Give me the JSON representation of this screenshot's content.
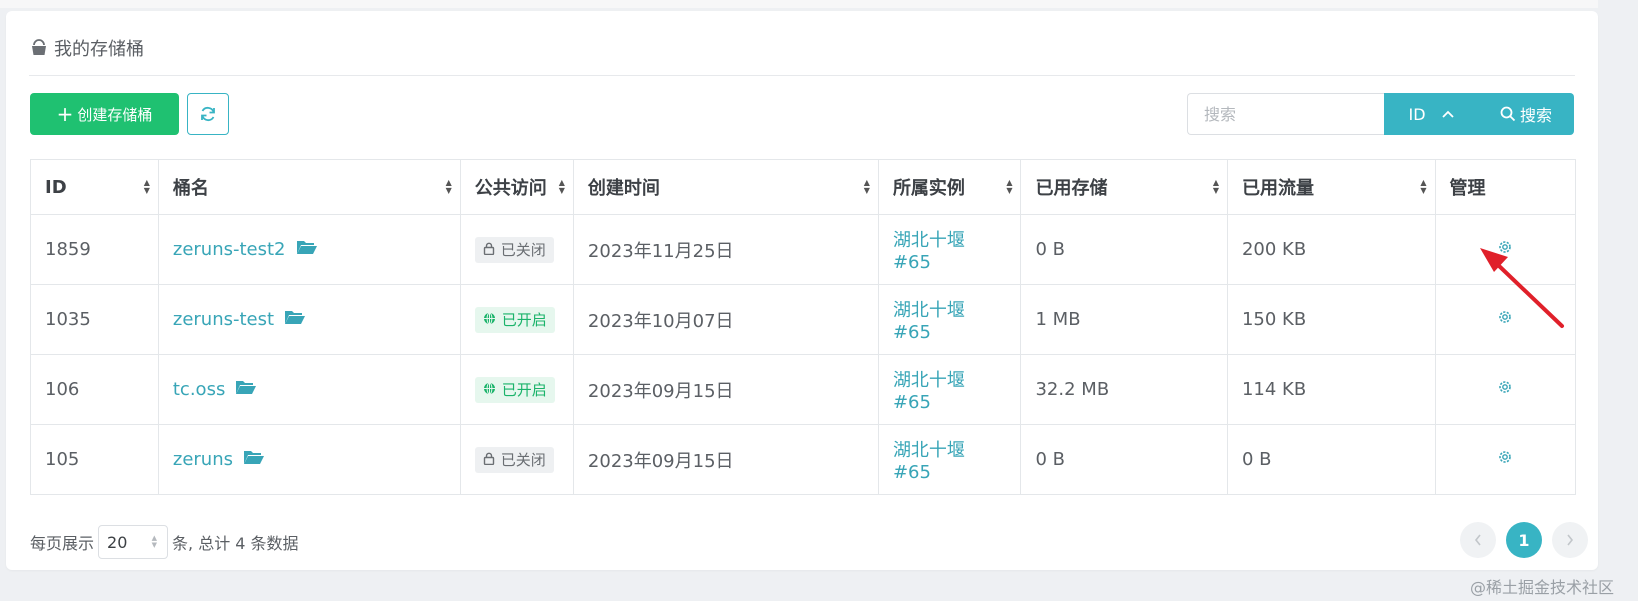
{
  "page": {
    "title": "我的存储桶"
  },
  "toolbar": {
    "create_label": "创建存储桶",
    "refresh_icon": "refresh-icon"
  },
  "search": {
    "placeholder": "搜索",
    "field": "ID",
    "button_label": "搜索"
  },
  "table": {
    "headers": [
      "ID",
      "桶名",
      "公共访问",
      "创建时间",
      "所属实例",
      "已用存储",
      "已用流量",
      "管理"
    ],
    "rows": [
      {
        "id": "1859",
        "name": "zeruns-test2",
        "access": "已关闭",
        "access_state": "closed",
        "created": "2023年11月25日",
        "instance": "湖北十堰 #65",
        "storage": "0 B",
        "traffic": "200 KB"
      },
      {
        "id": "1035",
        "name": "zeruns-test",
        "access": "已开启",
        "access_state": "open",
        "created": "2023年10月07日",
        "instance": "湖北十堰 #65",
        "storage": "1 MB",
        "traffic": "150 KB"
      },
      {
        "id": "106",
        "name": "tc.oss",
        "access": "已开启",
        "access_state": "open",
        "created": "2023年09月15日",
        "instance": "湖北十堰 #65",
        "storage": "32.2 MB",
        "traffic": "114 KB"
      },
      {
        "id": "105",
        "name": "zeruns",
        "access": "已关闭",
        "access_state": "closed",
        "created": "2023年09月15日",
        "instance": "湖北十堰 #65",
        "storage": "0 B",
        "traffic": "0 B"
      }
    ]
  },
  "footer": {
    "per_page_prefix": "每页展示",
    "per_page_value": "20",
    "total_text": "条, 总计 4 条数据"
  },
  "pagination": {
    "current_page": "1",
    "prev_icon": "chevron-left-icon",
    "next_icon": "chevron-right-icon"
  },
  "watermark": "@稀土掘金技术社区",
  "colors": {
    "accent": "#38b4c4",
    "create_button": "#1fc171",
    "open_badge": "#1ab36a",
    "annotation_arrow": "#e0202a"
  }
}
